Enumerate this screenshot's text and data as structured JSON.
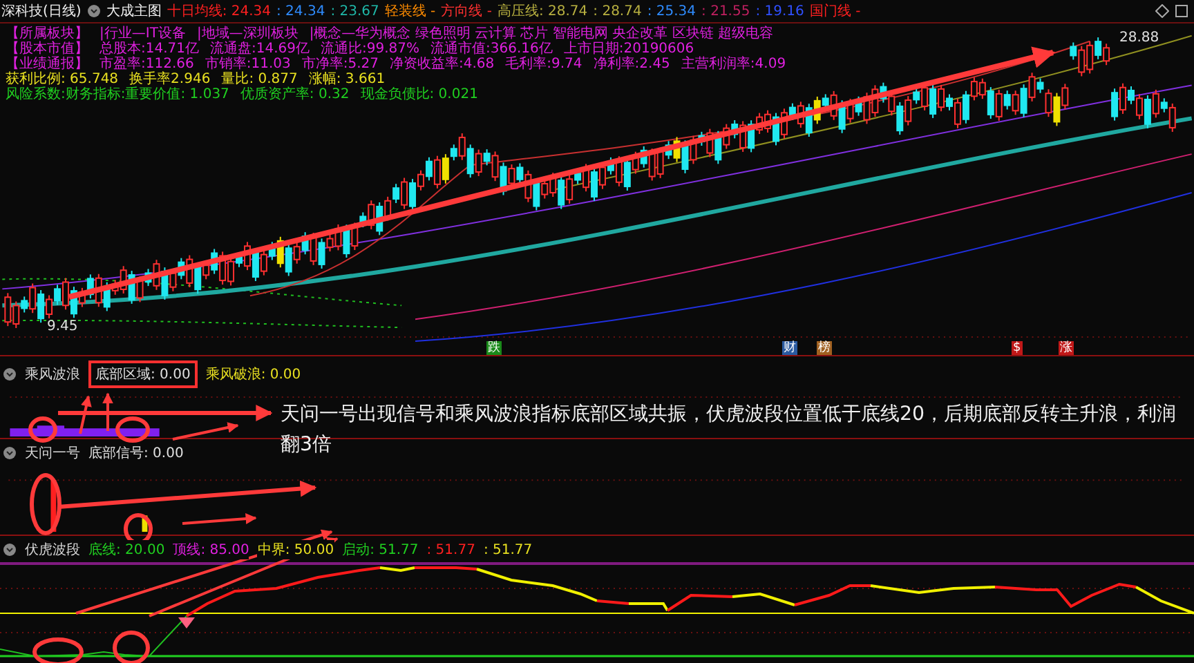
{
  "header": {
    "title": "深科技(日线)",
    "indicator": "大成主图",
    "values": [
      {
        "text": "十日均线: 24.34",
        "color": "#ff2020"
      },
      {
        "text": ": 24.34",
        "color": "#2f8cff"
      },
      {
        "text": ": 23.67",
        "color": "#1fb8a8"
      },
      {
        "text": "轻装线 -",
        "color": "#ff8c00"
      },
      {
        "text": "方向线 -",
        "color": "#ff3030"
      },
      {
        "text": "高压线: 28.74",
        "color": "#b8b040"
      },
      {
        "text": ": 28.74",
        "color": "#b8b040"
      },
      {
        "text": ": 25.34",
        "color": "#2f8cff"
      },
      {
        "text": ": 21.55",
        "color": "#c02060"
      },
      {
        "text": ": 19.16",
        "color": "#3050ff"
      },
      {
        "text": "国门线 -",
        "color": "#ff2020"
      }
    ]
  },
  "info_rows": [
    {
      "color": "#e020e0",
      "items": [
        "【所属板块】",
        "|行业—IT设备",
        "|地域—深圳板块",
        "|概念—华为概念 绿色照明 云计算 芯片 智能电网 央企改革 区块链 超级电容"
      ]
    },
    {
      "color": "#e020e0",
      "items": [
        "【股本市值】",
        "总股本:14.71亿",
        "流通盘:14.69亿",
        "流通比:99.87%",
        "流通市值:366.16亿",
        "上市日期:20190606"
      ]
    },
    {
      "color": "#e020e0",
      "items": [
        "【业绩通报】",
        "市盈率:112.66",
        "市销率:11.03",
        "市净率:5.27",
        "净资收益率:4.68",
        "毛利率:9.74",
        "净利率:2.45",
        "主营利润率:4.09"
      ]
    },
    {
      "color": "#e8e020",
      "items": [
        "获利比例: 65.748",
        "换手率2.946",
        "量比: 0.877",
        "涨幅: 3.661"
      ]
    },
    {
      "color": "#20d020",
      "items": [
        "风险系数:财务指标:重要价值: 1.037",
        "优质资产率: 0.32",
        "现金负债比: 0.021"
      ]
    }
  ],
  "price_labels": {
    "high": "28.88",
    "low": "9.45"
  },
  "markers": [
    {
      "text": "跌",
      "color": "#1a8a1a"
    },
    {
      "text": "财",
      "color": "#2a5aa0"
    },
    {
      "text": "榜",
      "color": "#a06020"
    },
    {
      "text": "$",
      "color": "#c01818"
    },
    {
      "text": "涨",
      "color": "#c01818"
    }
  ],
  "panels": [
    {
      "kind": "wave",
      "title": "乘风波浪",
      "values": [
        {
          "text": "底部区域: 0.00",
          "color": "#e0e0e0",
          "highlighted": true
        },
        {
          "text": "乘风破浪: 0.00",
          "color": "#e8e020",
          "highlighted": false
        }
      ]
    },
    {
      "kind": "signal",
      "title": "天问一号",
      "values": [
        {
          "text": "底部信号: 0.00",
          "color": "#e0e0e0",
          "highlighted": false
        }
      ]
    },
    {
      "kind": "oscillator",
      "title": "伏虎波段",
      "values": [
        {
          "text": "底线: 20.00",
          "color": "#20d020",
          "highlighted": false
        },
        {
          "text": "顶线: 85.00",
          "color": "#e020e0",
          "highlighted": false
        },
        {
          "text": "中界: 50.00",
          "color": "#e8e020",
          "highlighted": false
        },
        {
          "text": "启动: 51.77",
          "color": "#20d020",
          "highlighted": false
        },
        {
          "text": ": 51.77",
          "color": "#ff2020",
          "highlighted": false
        },
        {
          "text": ": 51.77",
          "color": "#e8e020",
          "highlighted": false
        }
      ]
    }
  ],
  "annotation": "天问一号出现信号和乘风波浪指标底部区域共振，伏虎波段位置低于底线20，后期底部反转主升浪，利润翻3倍"
}
